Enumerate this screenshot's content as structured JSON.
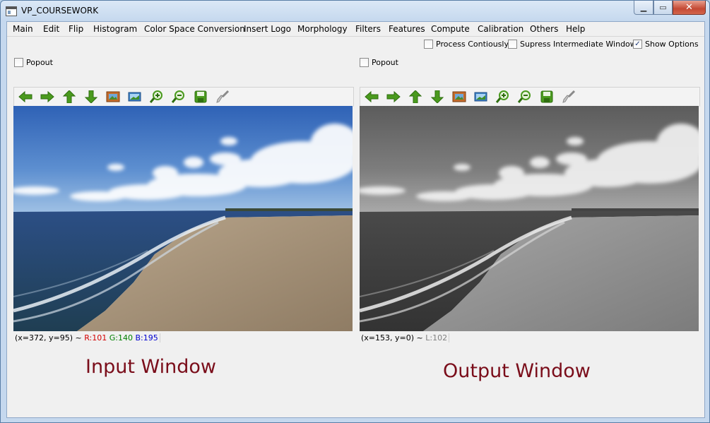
{
  "window": {
    "title": "VP_COURSEWORK",
    "min_glyph": "▁",
    "max_glyph": "▭",
    "close_glyph": "✕"
  },
  "menu": [
    "Main",
    "Edit",
    "Flip",
    "Histogram",
    "Color Space Conversion",
    "Insert Logo",
    "Morphology",
    "Filters",
    "Features",
    "Compute",
    "Calibration",
    "Others",
    "Help"
  ],
  "options": {
    "process_continuously": {
      "label": "Process Contiously",
      "checked": false
    },
    "suppress_intermediate": {
      "label": "Supress Intermediate Windows",
      "checked": false
    },
    "show_options": {
      "label": "Show Options",
      "checked": true,
      "check_glyph": "✓"
    }
  },
  "input_panel": {
    "popout_label": "Popout",
    "status_coords": "(x=372, y=95) ~ ",
    "status_r": "R:101",
    "status_g": "G:140",
    "status_b": "B:195",
    "caption": "Input Window"
  },
  "output_panel": {
    "popout_label": "Popout",
    "status_coords": "(x=153, y=0) ~ ",
    "status_l": "L:102",
    "caption": "Output Window"
  },
  "toolbar_icons": [
    "arrow-left-icon",
    "arrow-right-icon",
    "arrow-up-icon",
    "arrow-down-icon",
    "image-icon",
    "fit-to-window-icon",
    "zoom-in-icon",
    "zoom-out-icon",
    "save-icon",
    "clear-brush-icon"
  ],
  "colors": {
    "status_r": "#d40000",
    "status_g": "#008000",
    "status_b": "#0000d0",
    "status_l": "#808080",
    "caption": "#7a0d1a",
    "icon_green": "#4a9a1e"
  }
}
